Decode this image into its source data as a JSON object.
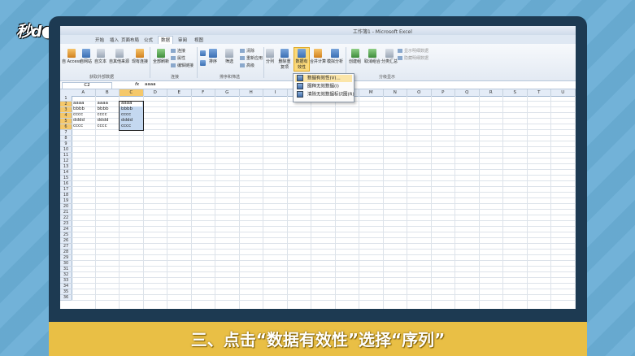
{
  "branding": {
    "logo_text": "秒d●ng视频"
  },
  "caption": "三、点击“数据有效性”选择“序列”",
  "window": {
    "title": "工作簿1 - Microsoft Excel"
  },
  "tabs": [
    "开始",
    "插入",
    "页面布局",
    "公式",
    "数据",
    "审阅",
    "视图"
  ],
  "active_tab": "数据",
  "ribbon": {
    "external_data": {
      "buttons": [
        "自 Access",
        "自网站",
        "自文本",
        "自其他来源",
        "现有连接"
      ],
      "label": "获取外部数据"
    },
    "connections": {
      "refresh": "全部刷新",
      "small": [
        "连接",
        "属性",
        "编辑链接"
      ],
      "label": "连接"
    },
    "sort_filter": {
      "sort": "排序",
      "filter": "筛选",
      "small": [
        "清除",
        "重新应用",
        "高级"
      ],
      "label": "排序和筛选"
    },
    "data_tools": {
      "buttons": [
        "分列",
        "删除重复项",
        "数据有效性",
        "合并计算",
        "模拟分析"
      ]
    },
    "outline": {
      "buttons": [
        "创建组",
        "取消组合",
        "分类汇总"
      ],
      "small": [
        "显示明细数据",
        "隐藏明细数据"
      ],
      "label": "分级显示"
    }
  },
  "formula_bar": {
    "name_box": "C2",
    "fx": "fx",
    "value": "aaaa"
  },
  "columns": [
    "A",
    "B",
    "C",
    "D",
    "E",
    "F",
    "G",
    "H",
    "I",
    "J",
    "K",
    "L",
    "M",
    "N",
    "O",
    "P",
    "Q",
    "R",
    "S",
    "T",
    "U"
  ],
  "rows": 36,
  "cells": [
    [
      "aaaa",
      "aaaa",
      "aaaa"
    ],
    [
      "bbbb",
      "bbbb",
      "bbbb"
    ],
    [
      "cccc",
      "cccc",
      "cccc"
    ],
    [
      "dddd",
      "dddd",
      "dddd"
    ],
    [
      "cccc",
      "cccc",
      "cccc"
    ]
  ],
  "dropdown": {
    "items": [
      "数据有效性(V)...",
      "圈释无效数据(I)",
      "清除无效数据标识圈(R)"
    ]
  }
}
